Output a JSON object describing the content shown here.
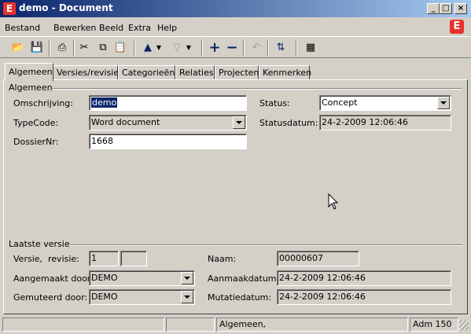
{
  "window": {
    "title": "demo - Document",
    "app_icon": "E"
  },
  "menu": {
    "items": [
      "Bestand",
      "Bewerken",
      "Beeld",
      "Extra",
      "Help"
    ]
  },
  "tabs": [
    "Algemeen",
    "Versies/revisies",
    "Categorieën",
    "Relaties",
    "Projecten",
    "Kenmerken"
  ],
  "general": {
    "group_label": "Algemeen",
    "omschrijving_label": "Omschrijving:",
    "omschrijving_value": "demo",
    "typecode_label": "TypeCode:",
    "typecode_value": "Word document",
    "dossiernr_label": "DossierNr:",
    "dossiernr_value": "1668",
    "status_label": "Status:",
    "status_value": "Concept",
    "statusdatum_label": "Statusdatum:",
    "statusdatum_value": "24-2-2009 12:06:46"
  },
  "latest": {
    "group_label": "Laatste versie",
    "versie_label": "Versie,  revisie:",
    "versie_value": "1",
    "revisie_value": "",
    "aangemaakt_label": "Aangemaakt door:",
    "aangemaakt_value": "DEMO",
    "gemuteerd_label": "Gemuteerd door:",
    "gemuteerd_value": "DEMO",
    "naam_label": "Naam:",
    "naam_value": "00000607",
    "aanmaakdatum_label": "Aanmaakdatum:",
    "aanmaakdatum_value": "24-2-2009 12:06:46",
    "mutatiedatum_label": "Mutatiedatum:",
    "mutatiedatum_value": "24-2-2009 12:06:46"
  },
  "statusbar": {
    "panel3": "Algemeen,",
    "panel4": "Adm 150"
  },
  "colors": {
    "titlebar": "#0a246a",
    "brand": "#e8322b",
    "face": "#d4d0c8"
  }
}
